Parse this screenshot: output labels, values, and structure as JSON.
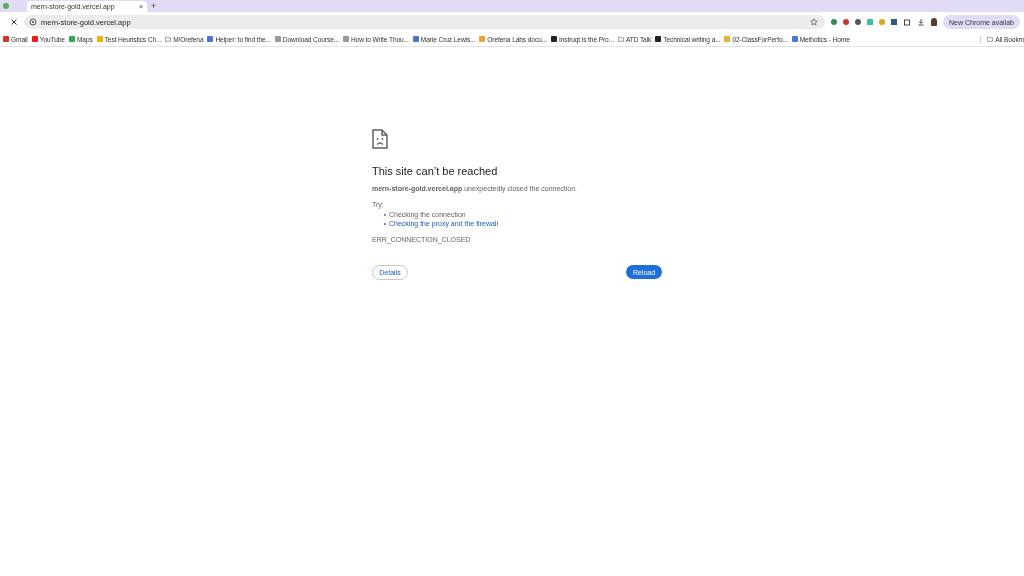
{
  "tab": {
    "title": "mern-store-gold.vercel.app",
    "close": "×",
    "new_tab": "+"
  },
  "address_bar": {
    "url": "mern-store-gold.vercel.app"
  },
  "update_button": "New Chrome availab",
  "bookmarks": [
    {
      "label": "Gmail",
      "kind": "gmail"
    },
    {
      "label": "YouTube",
      "kind": "youtube"
    },
    {
      "label": "Maps",
      "kind": "maps"
    },
    {
      "label": "Test Heuristics Ch...",
      "kind": "bulb"
    },
    {
      "label": "M/Orefena",
      "kind": "folder"
    },
    {
      "label": "Helper: to find the...",
      "kind": "doc"
    },
    {
      "label": "Download Course...",
      "kind": "page"
    },
    {
      "label": "How to Write Thou...",
      "kind": "page"
    },
    {
      "label": "Marie Cruz Lewis...",
      "kind": "doc"
    },
    {
      "label": "Orefena Labs docu...",
      "kind": "sun"
    },
    {
      "label": "Instruqt is the Pro...",
      "kind": "dark"
    },
    {
      "label": "ATD Talk",
      "kind": "folder"
    },
    {
      "label": "Technical writing a...",
      "kind": "dark"
    },
    {
      "label": "02-ClassForPerfo...",
      "kind": "tag"
    },
    {
      "label": "Methotics - Home",
      "kind": "doc"
    }
  ],
  "all_bookmarks": "All Bookm",
  "error": {
    "title": "This site can’t be reached",
    "message": "**mern-store-gold.vercel.app** unexpectedly closed the connection.",
    "try_label": "Try:",
    "suggestions": [
      {
        "text": "Checking the connection",
        "kind": "text"
      },
      {
        "text": "Checking the proxy and the firewall",
        "kind": "link"
      }
    ],
    "code": "ERR_CONNECTION_CLOSED",
    "details_button": "Details",
    "reload_button": "Reload"
  }
}
